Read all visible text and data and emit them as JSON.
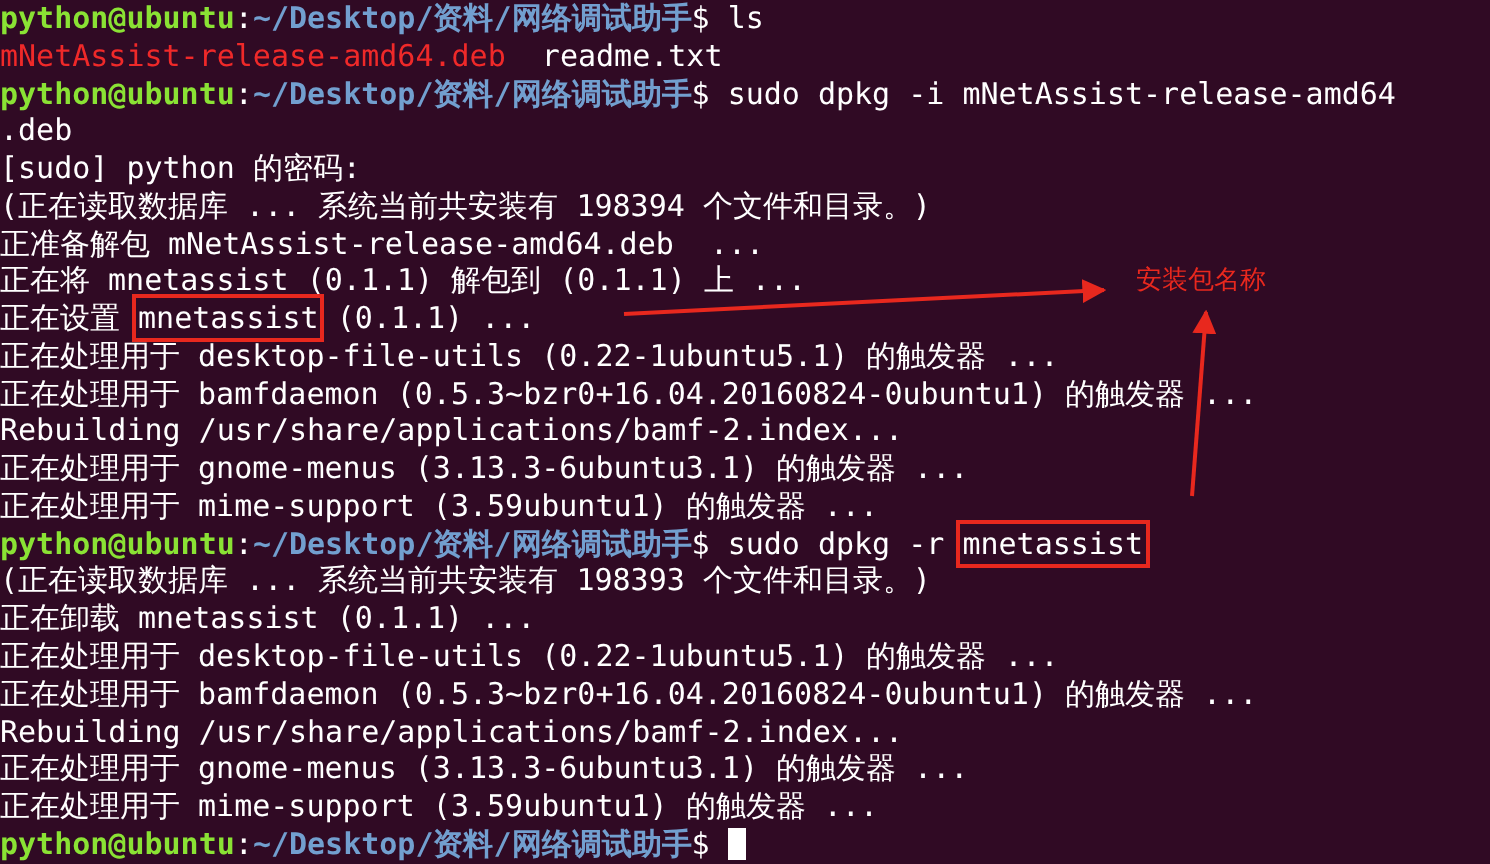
{
  "terminal": {
    "lines": [
      {
        "kind": "prompt",
        "user": "python@ubuntu",
        "separator": ":",
        "path": "~/Desktop/资料/网络调试助手",
        "symbol": "$",
        "command": [
          {
            "text": "ls"
          }
        ]
      },
      {
        "kind": "output",
        "segments": [
          {
            "text": "mNetAssist-release-amd64.deb",
            "color": "#ef2929"
          },
          {
            "text": "  readme.txt",
            "color": "#ffffff"
          }
        ]
      },
      {
        "kind": "prompt",
        "user": "python@ubuntu",
        "separator": ":",
        "path": "~/Desktop/资料/网络调试助手",
        "symbol": "$",
        "command": [
          {
            "text": "sudo dpkg -i mNetAssist-release-amd64"
          }
        ]
      },
      {
        "kind": "output",
        "segments": [
          {
            "text": ".deb",
            "color": "#ffffff"
          }
        ]
      },
      {
        "kind": "output",
        "segments": [
          {
            "text": "[sudo] python 的密码:",
            "color": "#ffffff"
          }
        ]
      },
      {
        "kind": "output",
        "segments": [
          {
            "text": "(正在读取数据库 ... 系统当前共安装有 198394 个文件和目录。)",
            "color": "#ffffff"
          }
        ]
      },
      {
        "kind": "output",
        "segments": [
          {
            "text": "正准备解包 mNetAssist-release-amd64.deb  ...",
            "color": "#ffffff"
          }
        ]
      },
      {
        "kind": "output",
        "segments": [
          {
            "text": "正在将 mnetassist (0.1.1) 解包到 (0.1.1) 上 ...",
            "color": "#ffffff"
          }
        ]
      },
      {
        "kind": "output",
        "segments": [
          {
            "text": "正在设置 ",
            "color": "#ffffff",
            "boxed": false
          },
          {
            "text": "mnetassist",
            "color": "#ffffff",
            "boxed": true
          },
          {
            "text": " (0.1.1) ...",
            "color": "#ffffff",
            "boxed": false
          }
        ]
      },
      {
        "kind": "output",
        "segments": [
          {
            "text": "正在处理用于 desktop-file-utils (0.22-1ubuntu5.1) 的触发器 ...",
            "color": "#ffffff"
          }
        ]
      },
      {
        "kind": "output",
        "segments": [
          {
            "text": "正在处理用于 bamfdaemon (0.5.3~bzr0+16.04.20160824-0ubuntu1) 的触发器 ...",
            "color": "#ffffff"
          }
        ]
      },
      {
        "kind": "output",
        "segments": [
          {
            "text": "Rebuilding /usr/share/applications/bamf-2.index...",
            "color": "#ffffff"
          }
        ]
      },
      {
        "kind": "output",
        "segments": [
          {
            "text": "正在处理用于 gnome-menus (3.13.3-6ubuntu3.1) 的触发器 ...",
            "color": "#ffffff"
          }
        ]
      },
      {
        "kind": "output",
        "segments": [
          {
            "text": "正在处理用于 mime-support (3.59ubuntu1) 的触发器 ...",
            "color": "#ffffff"
          }
        ]
      },
      {
        "kind": "prompt",
        "user": "python@ubuntu",
        "separator": ":",
        "path": "~/Desktop/资料/网络调试助手",
        "symbol": "$",
        "command": [
          {
            "text": "sudo dpkg -r ",
            "boxed": false
          },
          {
            "text": "mnetassist",
            "boxed": true
          }
        ]
      },
      {
        "kind": "output",
        "segments": [
          {
            "text": "(正在读取数据库 ... 系统当前共安装有 198393 个文件和目录。)",
            "color": "#ffffff"
          }
        ]
      },
      {
        "kind": "output",
        "segments": [
          {
            "text": "正在卸载 mnetassist (0.1.1) ...",
            "color": "#ffffff"
          }
        ]
      },
      {
        "kind": "output",
        "segments": [
          {
            "text": "正在处理用于 desktop-file-utils (0.22-1ubuntu5.1) 的触发器 ...",
            "color": "#ffffff"
          }
        ]
      },
      {
        "kind": "output",
        "segments": [
          {
            "text": "正在处理用于 bamfdaemon (0.5.3~bzr0+16.04.20160824-0ubuntu1) 的触发器 ...",
            "color": "#ffffff"
          }
        ]
      },
      {
        "kind": "output",
        "segments": [
          {
            "text": "Rebuilding /usr/share/applications/bamf-2.index...",
            "color": "#ffffff"
          }
        ]
      },
      {
        "kind": "output",
        "segments": [
          {
            "text": "正在处理用于 gnome-menus (3.13.3-6ubuntu3.1) 的触发器 ...",
            "color": "#ffffff"
          }
        ]
      },
      {
        "kind": "output",
        "segments": [
          {
            "text": "正在处理用于 mime-support (3.59ubuntu1) 的触发器 ...",
            "color": "#ffffff"
          }
        ]
      },
      {
        "kind": "prompt",
        "user": "python@ubuntu",
        "separator": ":",
        "path": "~/Desktop/资料/网络调试助手",
        "symbol": "$",
        "cursor": true
      }
    ]
  },
  "annotation": {
    "label": "安装包名称"
  }
}
